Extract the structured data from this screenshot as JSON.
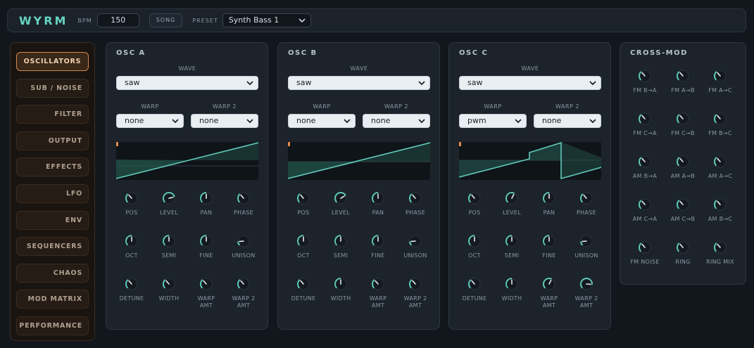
{
  "header": {
    "logo": "WYRM",
    "bpm_label": "BPM",
    "bpm_value": "150",
    "song_label": "SONG",
    "preset_label": "PRESET",
    "preset_value": "Synth Bass 1"
  },
  "sidebar": {
    "items": [
      {
        "label": "OSCILLATORS",
        "active": true
      },
      {
        "label": "SUB / NOISE",
        "active": false
      },
      {
        "label": "FILTER",
        "active": false
      },
      {
        "label": "OUTPUT",
        "active": false
      },
      {
        "label": "EFFECTS",
        "active": false
      },
      {
        "label": "LFO",
        "active": false
      },
      {
        "label": "ENV",
        "active": false
      },
      {
        "label": "SEQUENCERS",
        "active": false
      },
      {
        "label": "CHAOS",
        "active": false
      },
      {
        "label": "MOD MATRIX",
        "active": false
      },
      {
        "label": "PERFORMANCE",
        "active": false
      }
    ]
  },
  "oscillators": [
    {
      "title": "OSC A",
      "wave_label": "WAVE",
      "wave": "saw",
      "warp_label": "WARP",
      "warp": "none",
      "warp2_label": "WARP 2",
      "warp2": "none",
      "knobs": [
        {
          "label": "POS",
          "value": 0.35
        },
        {
          "label": "LEVEL",
          "value": 0.78
        },
        {
          "label": "PAN",
          "value": 0.5
        },
        {
          "label": "PHASE",
          "value": 0.35
        },
        {
          "label": "OCT",
          "value": 0.5
        },
        {
          "label": "SEMI",
          "value": 0.5
        },
        {
          "label": "FINE",
          "value": 0.5
        },
        {
          "label": "UNISON",
          "value": 0.15
        },
        {
          "label": "DETUNE",
          "value": 0.35
        },
        {
          "label": "WIDTH",
          "value": 0.35
        },
        {
          "label": "WARP\nAMT",
          "value": 0.35
        },
        {
          "label": "WARP 2\nAMT",
          "value": 0.35
        }
      ]
    },
    {
      "title": "OSC B",
      "wave_label": "WAVE",
      "wave": "saw",
      "warp_label": "WARP",
      "warp": "none",
      "warp2_label": "WARP 2",
      "warp2": "none",
      "knobs": [
        {
          "label": "POS",
          "value": 0.35
        },
        {
          "label": "LEVEL",
          "value": 0.72
        },
        {
          "label": "PAN",
          "value": 0.5
        },
        {
          "label": "PHASE",
          "value": 0.35
        },
        {
          "label": "OCT",
          "value": 0.5
        },
        {
          "label": "SEMI",
          "value": 0.5
        },
        {
          "label": "FINE",
          "value": 0.5
        },
        {
          "label": "UNISON",
          "value": 0.15
        },
        {
          "label": "DETUNE",
          "value": 0.35
        },
        {
          "label": "WIDTH",
          "value": 0.5
        },
        {
          "label": "WARP\nAMT",
          "value": 0.35
        },
        {
          "label": "WARP 2\nAMT",
          "value": 0.35
        }
      ]
    },
    {
      "title": "OSC C",
      "wave_label": "WAVE",
      "wave": "saw",
      "warp_label": "WARP",
      "warp": "pwm",
      "warp2_label": "WARP 2",
      "warp2": "none",
      "knobs": [
        {
          "label": "POS",
          "value": 0.35
        },
        {
          "label": "LEVEL",
          "value": 0.6
        },
        {
          "label": "PAN",
          "value": 0.5
        },
        {
          "label": "PHASE",
          "value": 0.35
        },
        {
          "label": "OCT",
          "value": 0.5
        },
        {
          "label": "SEMI",
          "value": 0.5
        },
        {
          "label": "FINE",
          "value": 0.5
        },
        {
          "label": "UNISON",
          "value": 0.15
        },
        {
          "label": "DETUNE",
          "value": 0.35
        },
        {
          "label": "WIDTH",
          "value": 0.5
        },
        {
          "label": "WARP\nAMT",
          "value": 0.6
        },
        {
          "label": "WARP 2\nAMT",
          "value": 0.85
        }
      ]
    }
  ],
  "cross_mod": {
    "title": "CROSS-MOD",
    "knobs": [
      {
        "label": "FM B→A",
        "value": 0.35
      },
      {
        "label": "FM A→B",
        "value": 0.35
      },
      {
        "label": "FM A→C",
        "value": 0.35
      },
      {
        "label": "FM C→A",
        "value": 0.35
      },
      {
        "label": "FM C→B",
        "value": 0.35
      },
      {
        "label": "FM B→C",
        "value": 0.35
      },
      {
        "label": "AM B→A",
        "value": 0.35
      },
      {
        "label": "AM A→B",
        "value": 0.35
      },
      {
        "label": "AM A→C",
        "value": 0.35
      },
      {
        "label": "AM C→A",
        "value": 0.35
      },
      {
        "label": "AM C→B",
        "value": 0.35
      },
      {
        "label": "AM B→C",
        "value": 0.35
      },
      {
        "label": "FM NOISE",
        "value": 0.35
      },
      {
        "label": "RING",
        "value": 0.35
      },
      {
        "label": "RING MIX",
        "value": 0.35
      }
    ]
  },
  "colors": {
    "accent_teal": "#5fc9b8",
    "accent_orange": "#d28a4e",
    "panel": "#1c232b",
    "background": "#12171d"
  }
}
